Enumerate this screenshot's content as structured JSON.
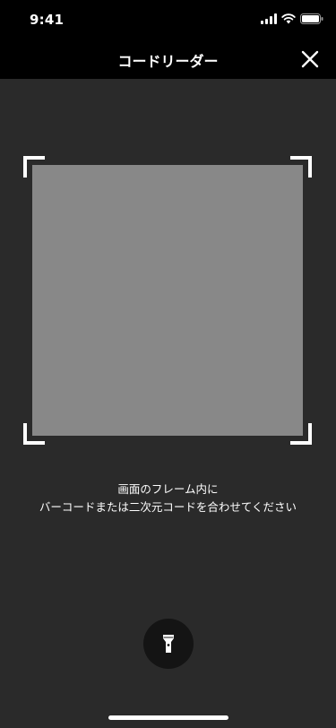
{
  "status_bar": {
    "time": "9:41",
    "icons": [
      "signal-icon",
      "wifi-icon",
      "battery-icon"
    ]
  },
  "nav": {
    "title": "コードリーダー",
    "close_icon": "close-icon"
  },
  "scanner": {
    "preview_color": "#888888",
    "frame_color": "#ffffff"
  },
  "instructions": {
    "line1": "画面のフレーム内に",
    "line2": "バーコードまたは二次元コードを合わせてください"
  },
  "torch": {
    "icon": "flashlight-icon"
  },
  "colors": {
    "background": "#2a2a2a",
    "bar": "#000000",
    "torch_button": "#141414",
    "text": "#ffffff"
  }
}
